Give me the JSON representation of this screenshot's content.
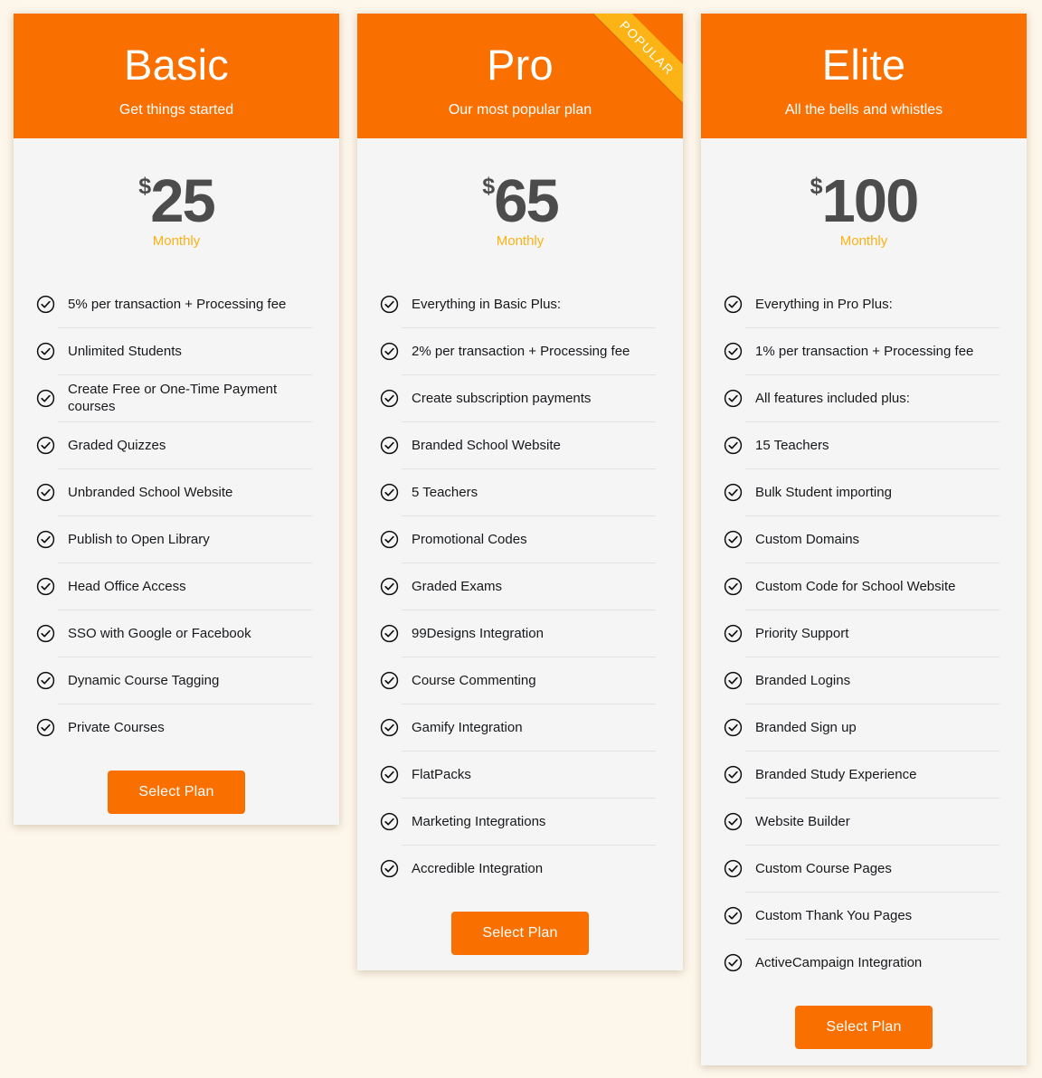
{
  "page": {
    "background_color": "#fdf6ea",
    "accent_color": "#fa7000",
    "ribbon_color": "#fcb316",
    "period_color": "#fbb215",
    "price_color": "#4c4c4c",
    "card_background": "#f5f5f5"
  },
  "cta_label": "Select Plan",
  "check_icon": "check-circle-icon",
  "plans": [
    {
      "id": "basic",
      "name": "Basic",
      "tagline": "Get things started",
      "currency": "$",
      "price": "25",
      "period": "Monthly",
      "badge": null,
      "cta": "Select Plan",
      "features": [
        "5% per transaction + Processing fee",
        "Unlimited Students",
        "Create Free or One-Time Payment courses",
        "Graded Quizzes",
        "Unbranded School Website",
        "Publish to Open Library",
        "Head Office Access",
        "SSO with Google or Facebook",
        "Dynamic Course Tagging",
        "Private Courses"
      ]
    },
    {
      "id": "pro",
      "name": "Pro",
      "tagline": "Our most popular plan",
      "currency": "$",
      "price": "65",
      "period": "Monthly",
      "badge": "POPULAR",
      "cta": "Select Plan",
      "features": [
        "Everything in Basic Plus:",
        "2% per transaction + Processing fee",
        "Create subscription payments",
        "Branded School Website",
        "5 Teachers",
        "Promotional Codes",
        "Graded Exams",
        "99Designs Integration",
        "Course Commenting",
        "Gamify Integration",
        "FlatPacks",
        "Marketing Integrations",
        "Accredible Integration"
      ]
    },
    {
      "id": "elite",
      "name": "Elite",
      "tagline": "All the bells and whistles",
      "currency": "$",
      "price": "100",
      "period": "Monthly",
      "badge": null,
      "cta": "Select Plan",
      "features": [
        "Everything in Pro Plus:",
        "1% per transaction + Processing fee",
        "All features included plus:",
        "15 Teachers",
        "Bulk Student importing",
        "Custom Domains",
        "Custom Code for School Website",
        "Priority Support",
        "Branded Logins",
        "Branded Sign up",
        "Branded Study Experience",
        "Website Builder",
        "Custom Course Pages",
        "Custom Thank You Pages",
        "ActiveCampaign Integration"
      ]
    }
  ]
}
